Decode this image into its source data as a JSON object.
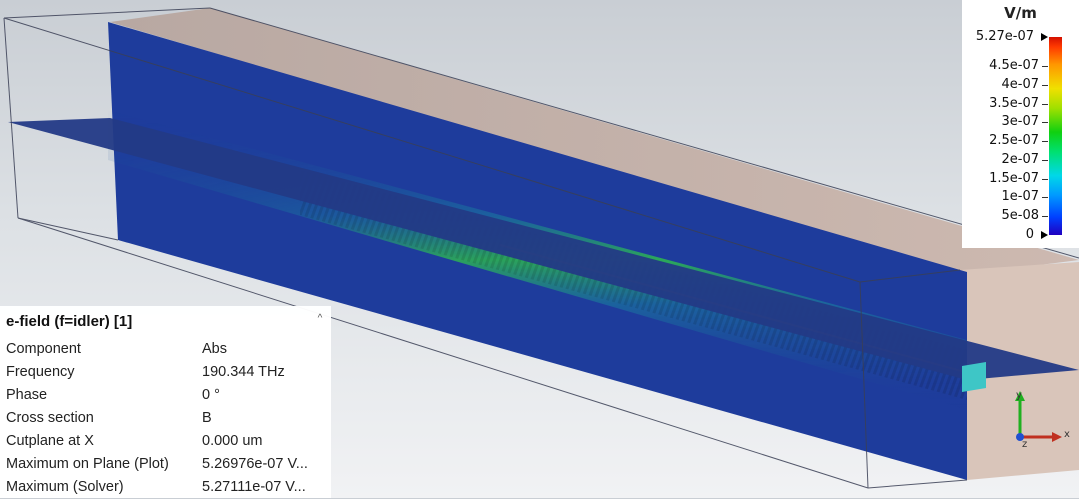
{
  "legend": {
    "unit": "V/m",
    "max_label": "5.27e-07",
    "min_label": "0",
    "ticks": [
      "4.5e-07",
      "4e-07",
      "3.5e-07",
      "3e-07",
      "2.5e-07",
      "2e-07",
      "1.5e-07",
      "1e-07",
      "5e-08"
    ],
    "colors": {
      "low": "#2000c0",
      "mid": "#10d010",
      "high": "#d41000"
    }
  },
  "properties": {
    "title": "e-field (f=idler) [1]",
    "rows": [
      {
        "key": "Component",
        "value": "Abs"
      },
      {
        "key": "Frequency",
        "value": "190.344 THz"
      },
      {
        "key": "Phase",
        "value": "0 °"
      },
      {
        "key": "Cross section",
        "value": "B"
      },
      {
        "key": "Cutplane at X",
        "value": "0.000 um"
      },
      {
        "key": "Maximum on Plane (Plot)",
        "value": "5.26976e-07 V..."
      },
      {
        "key": "Maximum (Solver)",
        "value": "5.27111e-07 V..."
      }
    ]
  },
  "axes": {
    "y_label": "y",
    "z_label": "z",
    "x_label": "x"
  },
  "colors": {
    "field_background": "#1f3a9a",
    "box_end_face": "#d8c2b6",
    "box_top_face": "#c7b4ac",
    "port": "#3ec6c6"
  }
}
